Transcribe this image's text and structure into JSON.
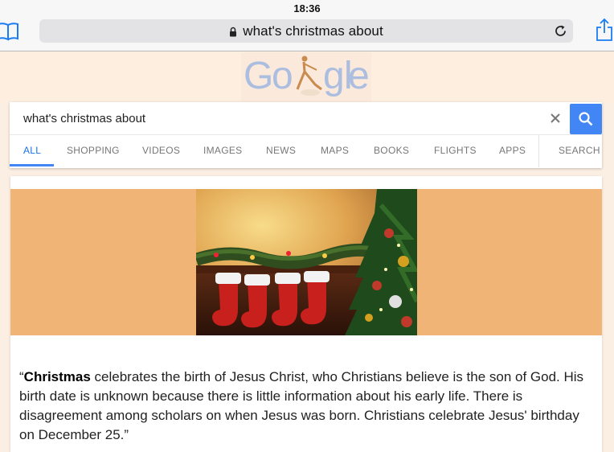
{
  "status_bar": {
    "time": "18:36"
  },
  "browser": {
    "address": "what's christmas about",
    "icons": [
      "bookmarks-icon",
      "lock-icon",
      "reload-icon",
      "share-icon"
    ]
  },
  "doodle": {
    "letters": [
      "G",
      "o",
      "g",
      "l",
      "e"
    ]
  },
  "search": {
    "query": "what's christmas about",
    "icons": [
      "clear-icon",
      "search-icon"
    ]
  },
  "tabs": [
    {
      "label": "ALL",
      "active": true
    },
    {
      "label": "SHOPPING"
    },
    {
      "label": "VIDEOS"
    },
    {
      "label": "IMAGES"
    },
    {
      "label": "NEWS"
    },
    {
      "label": "MAPS"
    },
    {
      "label": "BOOKS"
    },
    {
      "label": "FLIGHTS"
    },
    {
      "label": "APPS"
    },
    {
      "label": "SEARCH"
    }
  ],
  "result": {
    "open_quote": "“",
    "bold_term": "Christmas",
    "snippet": " celebrates the birth of Jesus Christ, who Christians believe is the son of God. His birth date is unknown because there is little information about his early life. There is disagreement among scholars on when Jesus was born. Christians celebrate Jesus' birthday on December 25.”"
  },
  "colors": {
    "accent_blue": "#4285f4",
    "image_band": "#f0b576",
    "doodle_bg": "#fdeee0"
  }
}
